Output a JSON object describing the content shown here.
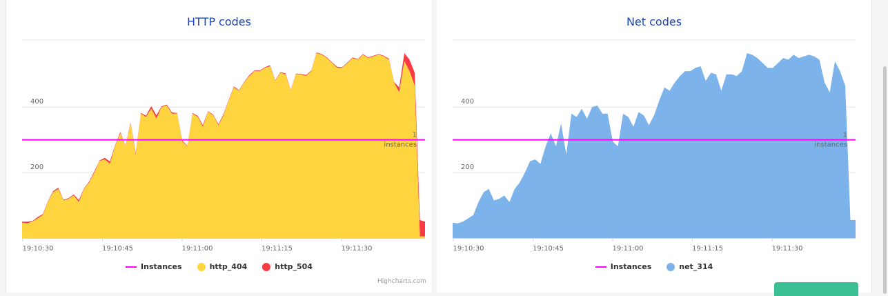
{
  "page": {
    "credits": "Highcharts.com",
    "colors": {
      "instances": "#ff00ff",
      "http_404": "#fed53e",
      "http_504": "#f93943",
      "net_314": "#7cb3ea",
      "title": "#1d47b6"
    }
  },
  "chart_data": [
    {
      "type": "area",
      "title": "HTTP codes",
      "stacked": true,
      "xlabel": "",
      "ylabel": "",
      "x_ticks": [
        "19:10:30",
        "19:10:45",
        "19:11:00",
        "19:11:15",
        "19:11:30"
      ],
      "y_ticks": [
        200,
        400
      ],
      "ylim": [
        0,
        605
      ],
      "grid": true,
      "legend_position": "bottom",
      "plot_line": {
        "name": "Instances",
        "value": 300,
        "label_value": "1",
        "label_unit": "instances"
      },
      "series": [
        {
          "name": "Instances",
          "kind": "line",
          "color": "#ff00ff"
        },
        {
          "name": "http_404",
          "kind": "area",
          "color": "#fed53e",
          "values": [
            47,
            45,
            50,
            60,
            70,
            110,
            140,
            150,
            115,
            120,
            130,
            110,
            150,
            170,
            200,
            235,
            240,
            227,
            280,
            320,
            280,
            350,
            255,
            380,
            370,
            395,
            365,
            400,
            405,
            380,
            380,
            295,
            280,
            380,
            370,
            340,
            385,
            375,
            345,
            375,
            420,
            460,
            450,
            475,
            495,
            510,
            510,
            520,
            525,
            480,
            505,
            500,
            450,
            500,
            500,
            495,
            510,
            565,
            560,
            550,
            535,
            520,
            520,
            535,
            550,
            545,
            560,
            550,
            555,
            560,
            555,
            545,
            475,
            445,
            540,
            510,
            465,
            5,
            5
          ]
        },
        {
          "name": "http_504",
          "kind": "area",
          "color": "#f93943",
          "values": [
            3,
            5,
            2,
            4,
            3,
            2,
            3,
            4,
            2,
            2,
            3,
            6,
            2,
            3,
            4,
            2,
            5,
            7,
            3,
            4,
            2,
            3,
            5,
            2,
            4,
            8,
            10,
            2,
            3,
            4,
            2,
            3,
            2,
            2,
            3,
            5,
            2,
            2,
            3,
            4,
            2,
            3,
            2,
            2,
            3,
            2,
            2,
            2,
            3,
            2,
            2,
            3,
            2,
            2,
            2,
            3,
            2,
            2,
            2,
            2,
            2,
            3,
            2,
            2,
            2,
            2,
            2,
            2,
            2,
            2,
            2,
            3,
            2,
            15,
            25,
            35,
            40,
            50,
            45
          ]
        }
      ],
      "x_start": 0,
      "x_end": 78
    },
    {
      "type": "area",
      "title": "Net codes",
      "xlabel": "",
      "ylabel": "",
      "x_ticks": [
        "19:10:30",
        "19:10:45",
        "19:11:00",
        "19:11:15",
        "19:11:30"
      ],
      "y_ticks": [
        200,
        400
      ],
      "ylim": [
        0,
        605
      ],
      "grid": true,
      "legend_position": "bottom",
      "plot_line": {
        "name": "Instances",
        "value": 300,
        "label_value": "1",
        "label_unit": "instances"
      },
      "series": [
        {
          "name": "Instances",
          "kind": "line",
          "color": "#ff00ff"
        },
        {
          "name": "net_314",
          "kind": "area",
          "color": "#7cb3ea",
          "values": [
            47,
            45,
            50,
            60,
            70,
            110,
            140,
            150,
            115,
            120,
            130,
            110,
            150,
            170,
            200,
            235,
            240,
            227,
            280,
            320,
            280,
            350,
            255,
            380,
            370,
            395,
            365,
            400,
            405,
            380,
            380,
            295,
            280,
            380,
            370,
            340,
            385,
            375,
            345,
            375,
            420,
            460,
            450,
            475,
            495,
            510,
            510,
            520,
            525,
            480,
            505,
            500,
            450,
            500,
            500,
            495,
            510,
            565,
            560,
            550,
            535,
            520,
            520,
            535,
            550,
            545,
            560,
            550,
            555,
            560,
            555,
            545,
            475,
            445,
            540,
            510,
            465,
            55,
            55
          ]
        }
      ],
      "x_start": 0,
      "x_end": 78
    }
  ]
}
